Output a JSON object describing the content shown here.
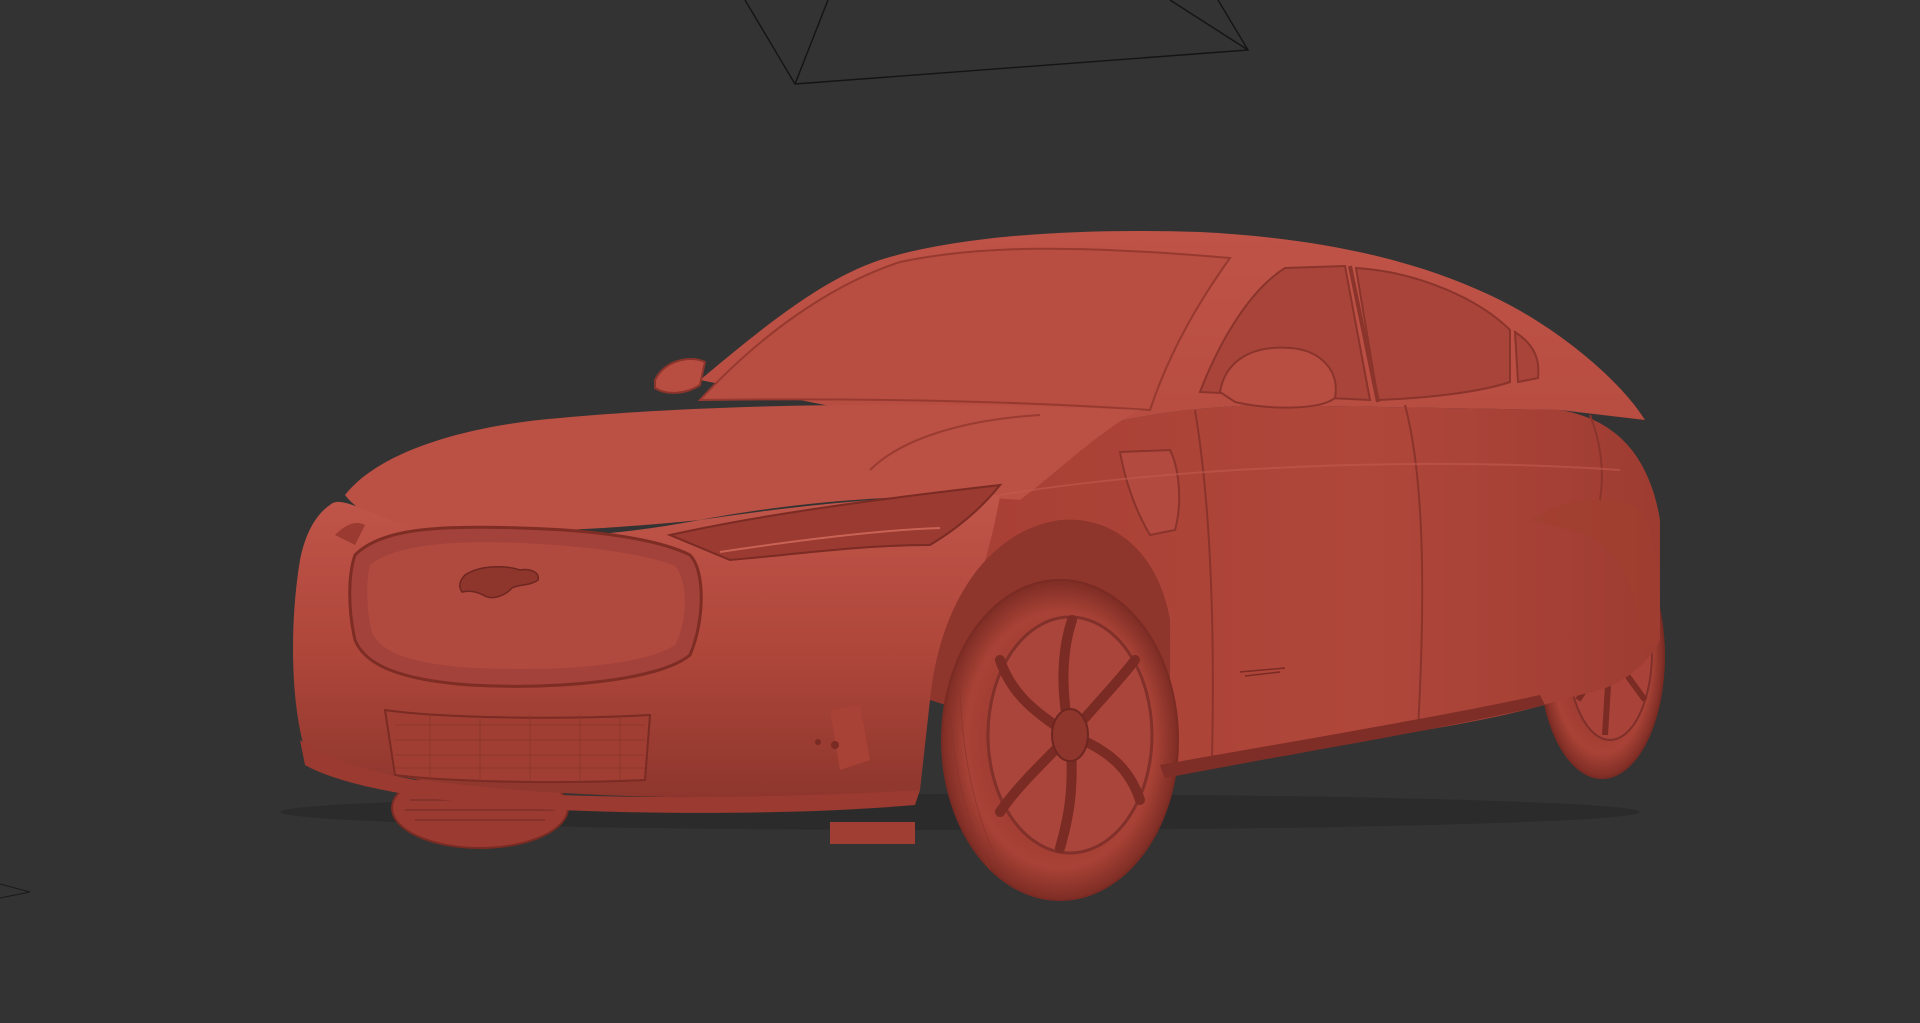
{
  "viewport": {
    "background": "#333333",
    "wireframe_color": "#141414"
  },
  "model": {
    "render_mode": "clay",
    "body_color": "#B0473B",
    "highlight_color": "#C4564A",
    "shadow_color": "#7A2A22"
  },
  "scene_objects": [
    {
      "name": "camera-gizmo",
      "kind": "wireframe"
    },
    {
      "name": "light-gizmo",
      "kind": "wireframe"
    }
  ]
}
